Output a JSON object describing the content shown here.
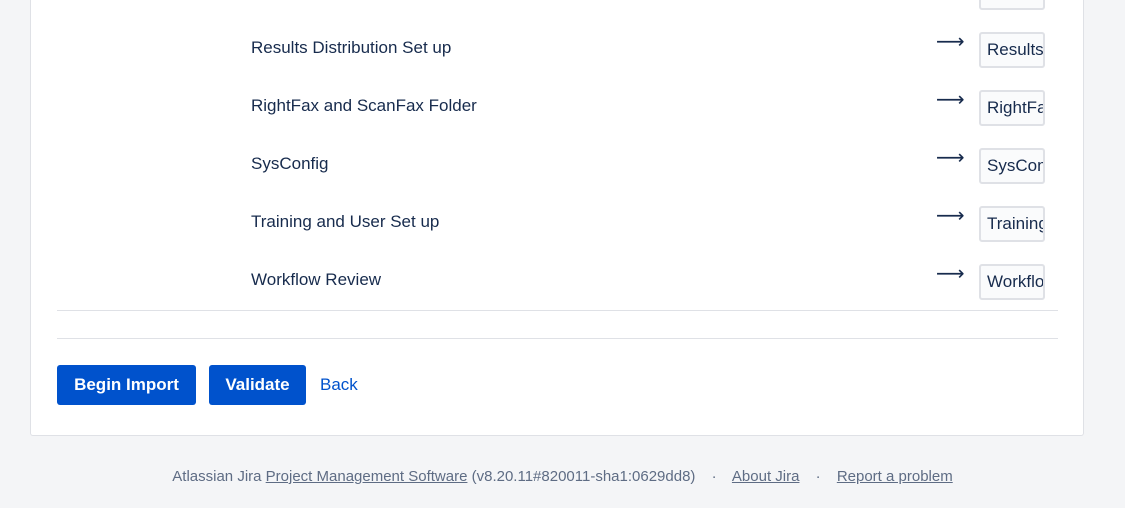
{
  "mapping": {
    "arrow_glyph": "⟶",
    "rows": [
      {
        "label": "Results Distribution Set up",
        "value": "Results Distribution Set up"
      },
      {
        "label": "RightFax and ScanFax Folder",
        "value": "RightFax and ScanFax Folder"
      },
      {
        "label": "SysConfig",
        "value": "SysConfig"
      },
      {
        "label": "Training and User Set up",
        "value": "Training and User Set up"
      },
      {
        "label": "Workflow Review",
        "value": "Workflow Review"
      }
    ]
  },
  "actions": {
    "begin_import_label": "Begin Import",
    "validate_label": "Validate",
    "back_label": "Back"
  },
  "footer": {
    "prefix": "Atlassian Jira",
    "product_link": "Project Management Software",
    "version": "(v8.20.11#820011-sha1:0629dd8)",
    "separator": "·",
    "about_link": "About Jira",
    "report_link": "Report a problem"
  },
  "colors": {
    "primary": "#0052cc",
    "page_background": "#f4f5f7",
    "text": "#172b4d",
    "muted": "#5e6c84",
    "border": "#dfe1e6"
  }
}
